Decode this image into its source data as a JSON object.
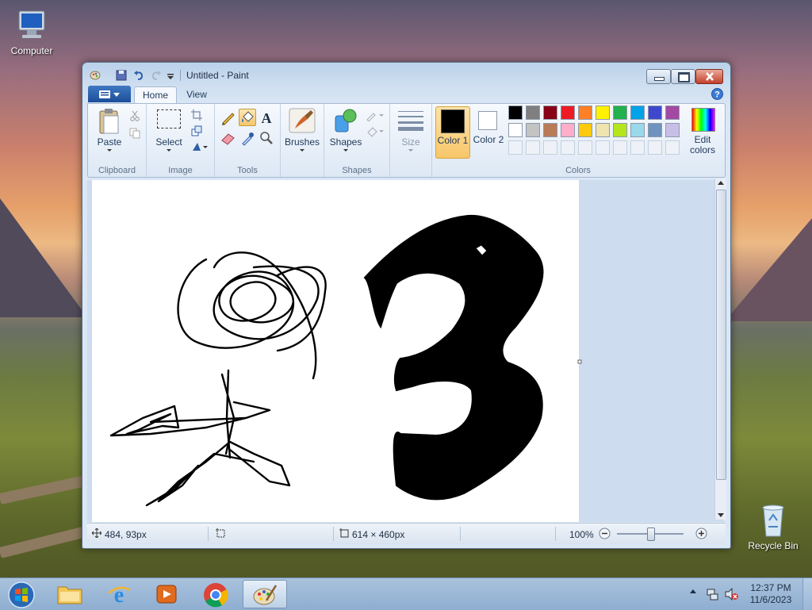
{
  "desktop": {
    "icons": [
      {
        "label": "Computer",
        "icon": "computer-icon"
      },
      {
        "label": "Recycle Bin",
        "icon": "recycle-bin-icon"
      }
    ]
  },
  "window": {
    "title": "Untitled - Paint",
    "tabs": [
      {
        "label": "Home",
        "active": true
      },
      {
        "label": "View",
        "active": false
      }
    ],
    "ribbon": {
      "clipboard": {
        "paste_label": "Paste",
        "group_label": "Clipboard"
      },
      "image": {
        "select_label": "Select",
        "group_label": "Image"
      },
      "tools": {
        "group_label": "Tools"
      },
      "brushes": {
        "label": "Brushes"
      },
      "shapes": {
        "label": "Shapes",
        "group_label": "Shapes"
      },
      "size": {
        "label": "Size"
      },
      "color1": {
        "label": "Color 1",
        "value": "#000000"
      },
      "color2": {
        "label": "Color 2",
        "value": "#ffffff"
      },
      "colors": {
        "group_label": "Colors",
        "edit_label": "Edit colors",
        "row1": [
          "#000000",
          "#7f7f7f",
          "#880015",
          "#ed1c24",
          "#ff7f27",
          "#fff200",
          "#22b14c",
          "#00a2e8",
          "#3f48cc",
          "#a349a4"
        ],
        "row2": [
          "#ffffff",
          "#c3c3c3",
          "#b97a57",
          "#ffaec9",
          "#ffc90e",
          "#efe4b0",
          "#b5e61d",
          "#99d9ea",
          "#7092be",
          "#c8bfe7"
        ]
      }
    },
    "status": {
      "cursor_pos": "484, 93px",
      "image_size": "614 × 460px",
      "zoom": "100%"
    }
  },
  "taskbar": {
    "time": "12:37 PM",
    "date": "11/6/2023",
    "apps": [
      "start-button",
      "file-explorer",
      "internet-explorer",
      "media-player",
      "chrome",
      "paint"
    ]
  }
}
